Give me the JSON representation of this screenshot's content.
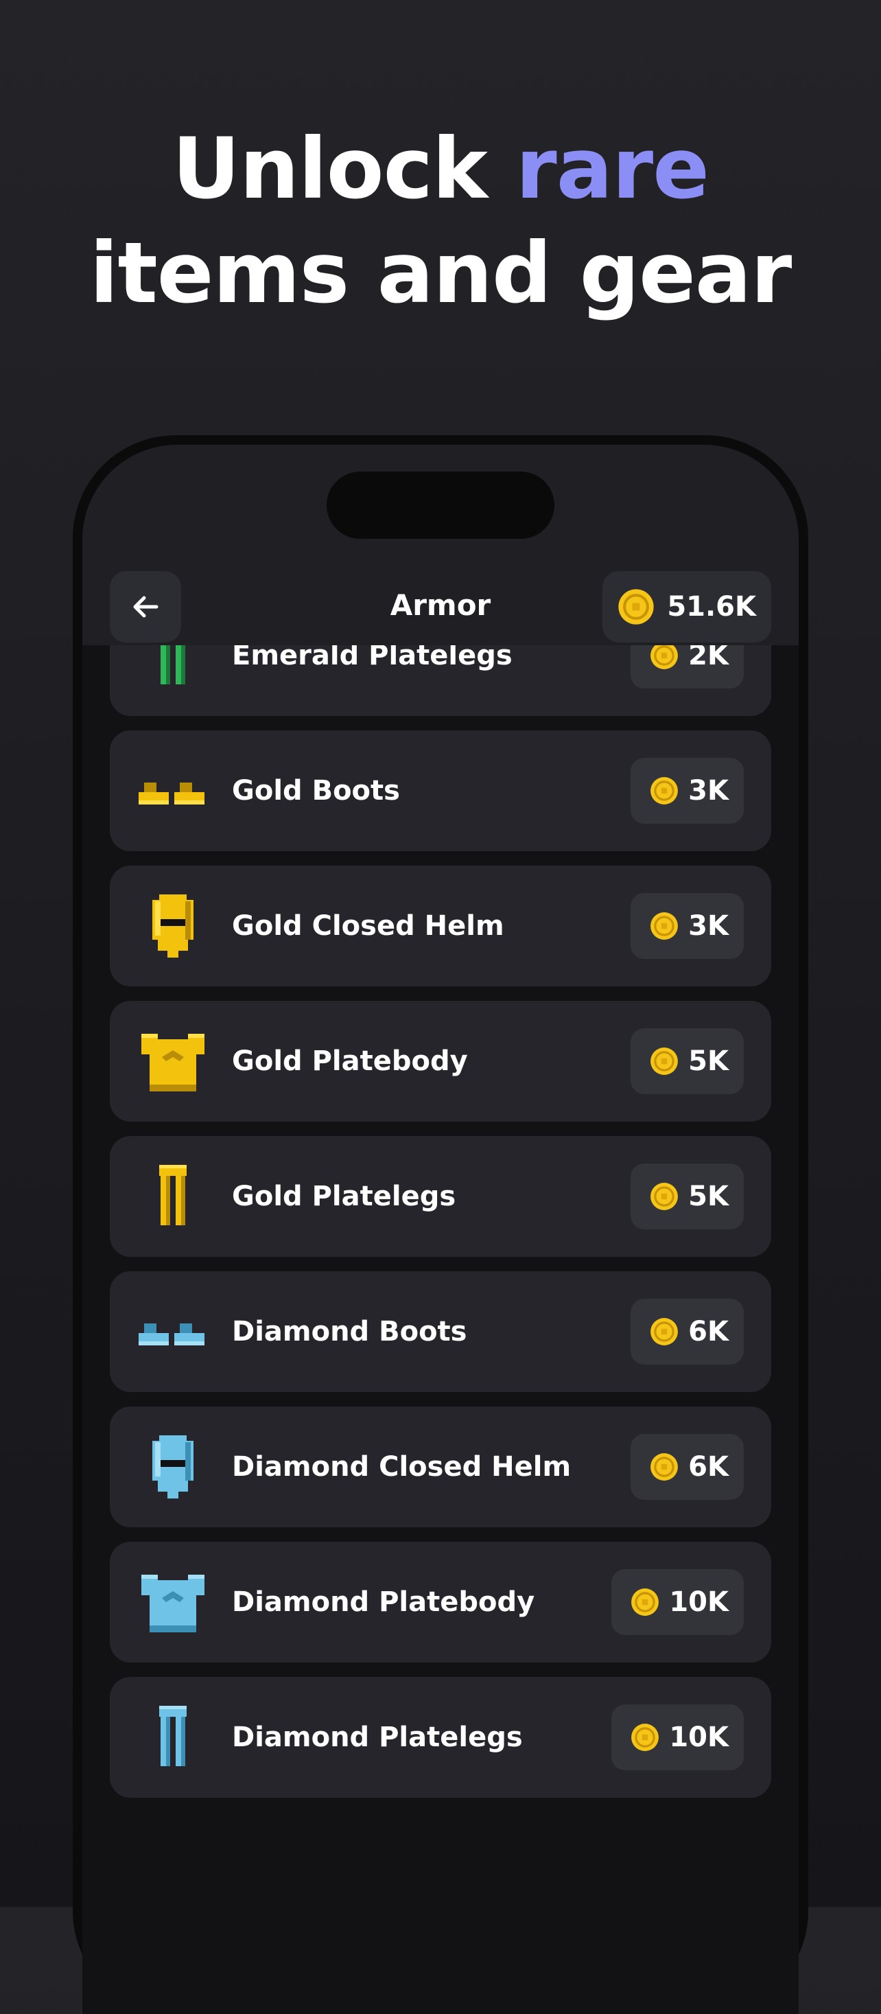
{
  "headline": {
    "line1_plain": "Unlock ",
    "line1_accent": "rare",
    "line2": "items and gear"
  },
  "header": {
    "title": "Armor",
    "balance": "51.6K",
    "back_icon": "arrow-left-icon",
    "coin_icon": "coin-icon"
  },
  "colors": {
    "accent": "#8b8ff5",
    "coin": "#f5c518",
    "emerald": "#2fb75a",
    "gold": "#f3c20c",
    "diamond": "#6ec3e6"
  },
  "items": [
    {
      "name": "",
      "price": "",
      "icon": "emerald-platebody-icon",
      "material": "emerald",
      "kind": "body"
    },
    {
      "name": "Emerald Platelegs",
      "price": "2K",
      "icon": "emerald-platelegs-icon",
      "material": "emerald",
      "kind": "legs"
    },
    {
      "name": "Gold Boots",
      "price": "3K",
      "icon": "gold-boots-icon",
      "material": "gold",
      "kind": "boots"
    },
    {
      "name": "Gold Closed Helm",
      "price": "3K",
      "icon": "gold-closed-helm-icon",
      "material": "gold",
      "kind": "helm"
    },
    {
      "name": "Gold Platebody",
      "price": "5K",
      "icon": "gold-platebody-icon",
      "material": "gold",
      "kind": "body"
    },
    {
      "name": "Gold Platelegs",
      "price": "5K",
      "icon": "gold-platelegs-icon",
      "material": "gold",
      "kind": "legs"
    },
    {
      "name": "Diamond Boots",
      "price": "6K",
      "icon": "diamond-boots-icon",
      "material": "diamond",
      "kind": "boots"
    },
    {
      "name": "Diamond Closed Helm",
      "price": "6K",
      "icon": "diamond-closed-helm-icon",
      "material": "diamond",
      "kind": "helm"
    },
    {
      "name": "Diamond Platebody",
      "price": "10K",
      "icon": "diamond-platebody-icon",
      "material": "diamond",
      "kind": "body"
    },
    {
      "name": "Diamond Platelegs",
      "price": "10K",
      "icon": "diamond-platelegs-icon",
      "material": "diamond",
      "kind": "legs"
    }
  ]
}
